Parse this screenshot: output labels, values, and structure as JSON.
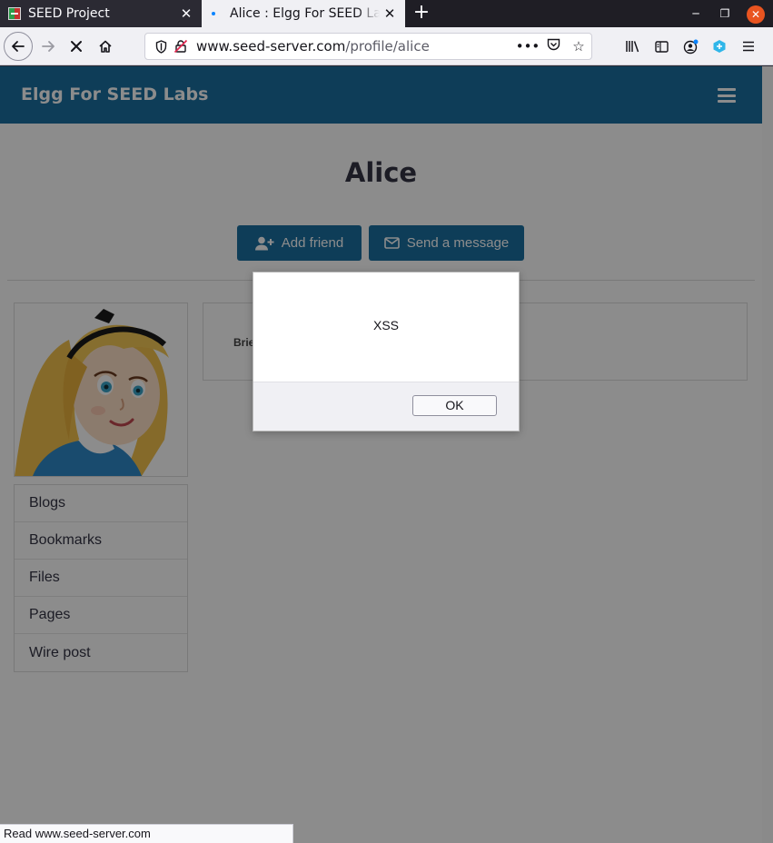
{
  "browser": {
    "tabs": [
      {
        "title": "SEED Project",
        "active": false,
        "favicon": "seed-logo-icon"
      },
      {
        "title": "Alice : Elgg For SEED Labs",
        "active": true,
        "favicon": "loading-dot-icon"
      }
    ],
    "url": {
      "domain": "www.seed-server.com",
      "path": "/profile/alice"
    },
    "status_text": "Read www.seed-server.com"
  },
  "site": {
    "title": "Elgg For SEED Labs",
    "header_color": "#1b6fa0"
  },
  "profile": {
    "name": "Alice",
    "actions": {
      "add_friend": "Add friend",
      "send_message": "Send a message"
    },
    "details_label": "Brief description",
    "menu": [
      "Blogs",
      "Bookmarks",
      "Files",
      "Pages",
      "Wire post"
    ]
  },
  "dialog": {
    "message": "XSS",
    "ok_label": "OK"
  }
}
